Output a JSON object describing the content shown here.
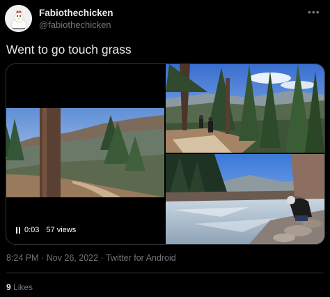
{
  "user": {
    "display_name": "Fabiothechicken",
    "handle": "@fabiothechicken"
  },
  "tweet": {
    "text": "Went to go touch grass"
  },
  "video": {
    "elapsed": "0:03",
    "views": "57 views"
  },
  "meta": {
    "time": "8:24 PM",
    "date": "Nov 26, 2022",
    "separator": "·",
    "source": "Twitter for Android"
  },
  "stats": {
    "likes_count": "9",
    "likes_label": "Likes"
  },
  "icons": {
    "more": "more-icon",
    "pause": "pause-icon"
  },
  "colors": {
    "background": "#000000",
    "text": "#e7e9ea",
    "secondary": "#71767b",
    "border": "#2f3336"
  }
}
